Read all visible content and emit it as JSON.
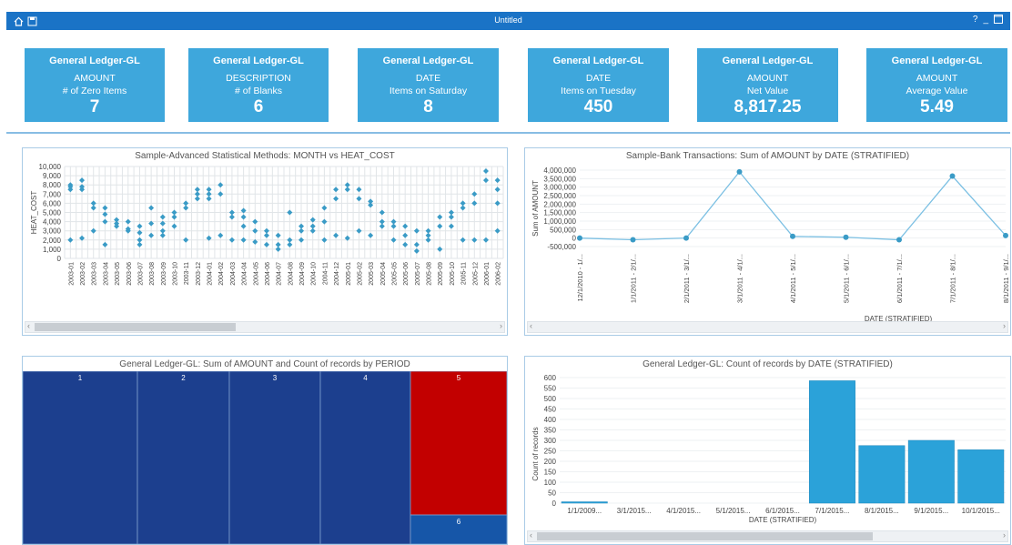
{
  "window": {
    "title": "Untitled",
    "help_label": "?",
    "minimize_label": "_"
  },
  "kpis": [
    {
      "header": "General Ledger-GL",
      "field": "AMOUNT",
      "metric": "# of Zero Items",
      "value": "7"
    },
    {
      "header": "General Ledger-GL",
      "field": "DESCRIPTION",
      "metric": "# of Blanks",
      "value": "6"
    },
    {
      "header": "General Ledger-GL",
      "field": "DATE",
      "metric": "Items on Saturday",
      "value": "8"
    },
    {
      "header": "General Ledger-GL",
      "field": "DATE",
      "metric": "Items on Tuesday",
      "value": "450"
    },
    {
      "header": "General Ledger-GL",
      "field": "AMOUNT",
      "metric": "Net Value",
      "value": "8,817.25"
    },
    {
      "header": "General Ledger-GL",
      "field": "AMOUNT",
      "metric": "Average Value",
      "value": "5.49"
    }
  ],
  "chart_data": [
    {
      "type": "scatter",
      "title": "Sample-Advanced Statistical Methods: MONTH vs HEAT_COST",
      "ylabel": "HEAT_COST",
      "xlabel": "",
      "ylim": [
        0,
        10000
      ],
      "yticks": [
        "10,000",
        "9,000",
        "8,000",
        "7,000",
        "6,000",
        "5,000",
        "4,000",
        "3,000",
        "2,000",
        "1,000",
        "0"
      ],
      "categories": [
        "2003-01",
        "2003-02",
        "2003-03",
        "2003-04",
        "2003-05",
        "2003-06",
        "2003-07",
        "2003-08",
        "2003-09",
        "2003-10",
        "2003-11",
        "2003-12",
        "2004-01",
        "2004-02",
        "2004-03",
        "2004-04",
        "2004-05",
        "2004-06",
        "2004-07",
        "2004-08",
        "2004-09",
        "2004-10",
        "2004-11",
        "2004-12",
        "2005-01",
        "2005-02",
        "2005-03",
        "2005-04",
        "2005-05",
        "2005-06",
        "2005-07",
        "2005-08",
        "2005-09",
        "2005-10",
        "2005-11",
        "2005-12",
        "2006-01",
        "2006-02"
      ],
      "series": [
        {
          "values": [
            [
              2000,
              7500,
              8000,
              7800
            ],
            [
              8500,
              7800,
              7500,
              2200
            ],
            [
              6000,
              5500,
              3000
            ],
            [
              5500,
              4800,
              4000,
              1500
            ],
            [
              4200,
              3500,
              3800
            ],
            [
              4000,
              3200,
              3000
            ],
            [
              3500,
              2800,
              1500,
              2000
            ],
            [
              5500,
              3800,
              2500
            ],
            [
              4500,
              3800,
              3000,
              2500
            ],
            [
              5000,
              4500,
              3500
            ],
            [
              6000,
              5500,
              2000
            ],
            [
              7500,
              6500,
              7000
            ],
            [
              7500,
              6500,
              7000,
              2200
            ],
            [
              8000,
              7000,
              2500
            ],
            [
              5000,
              4500,
              2000
            ],
            [
              5200,
              4500,
              3500,
              2000
            ],
            [
              4000,
              3000,
              1800
            ],
            [
              3000,
              2500,
              1500
            ],
            [
              2500,
              1500,
              1000
            ],
            [
              5000,
              2000,
              1500
            ],
            [
              3500,
              3000,
              2000
            ],
            [
              4200,
              3500,
              3000
            ],
            [
              5500,
              4000,
              2000
            ],
            [
              7500,
              6500,
              2500
            ],
            [
              8000,
              7500,
              2200
            ],
            [
              7500,
              6500,
              3000
            ],
            [
              6200,
              5800,
              2500
            ],
            [
              5000,
              4000,
              3500
            ],
            [
              4000,
              3500,
              2000
            ],
            [
              3500,
              2500,
              1500
            ],
            [
              3000,
              1500,
              800
            ],
            [
              3000,
              2500,
              2000
            ],
            [
              4500,
              3500,
              1000
            ],
            [
              5000,
              4500,
              3500
            ],
            [
              6000,
              5500,
              2000
            ],
            [
              7000,
              6000,
              2000
            ],
            [
              9500,
              8500,
              2000
            ],
            [
              8500,
              7500,
              6000,
              3000
            ]
          ]
        }
      ],
      "scrollbar_position": 0.42
    },
    {
      "type": "line",
      "title": "Sample-Bank Transactions: Sum of AMOUNT by DATE (STRATIFIED)",
      "ylabel": "Sum of AMOUNT",
      "xlabel": "DATE (STRATIFIED)",
      "ylim": [
        -500000,
        4000000
      ],
      "yticks": [
        "4,000,000",
        "3,500,000",
        "3,000,000",
        "2,500,000",
        "2,000,000",
        "1,500,000",
        "1,000,000",
        "500,000",
        "0",
        "-500,000"
      ],
      "categories": [
        "12/1/2010 - 1/...",
        "1/1/2011 - 2/1/...",
        "2/1/2011 - 3/1/...",
        "3/1/2011 - 4/1/...",
        "4/1/2011 - 5/1/...",
        "5/1/2011 - 6/1/...",
        "6/1/2011 - 7/1/...",
        "7/1/2011 - 8/1/...",
        "8/1/2011 - 9/1/..."
      ],
      "series": [
        {
          "values": [
            0,
            -100000,
            0,
            3900000,
            100000,
            50000,
            -100000,
            3650000,
            150000
          ]
        }
      ]
    },
    {
      "type": "treemap",
      "title": "General Ledger-GL: Sum of AMOUNT and Count of records by PERIOD",
      "categories": [
        "1",
        "2",
        "3",
        "4",
        "5",
        "6"
      ],
      "colors": {
        "normal": "#1c3f8e",
        "highlight": "#c20000",
        "alt": "#1656a8"
      }
    },
    {
      "type": "bar",
      "title": "General Ledger-GL: Count of records by DATE (STRATIFIED)",
      "ylabel": "Count of records",
      "xlabel": "DATE (STRATIFIED)",
      "ylim": [
        0,
        600
      ],
      "yticks": [
        "600",
        "550",
        "500",
        "450",
        "400",
        "350",
        "300",
        "250",
        "200",
        "150",
        "100",
        "50",
        "0"
      ],
      "categories": [
        "1/1/2009...",
        "3/1/2015...",
        "4/1/2015...",
        "5/1/2015...",
        "6/1/2015...",
        "7/1/2015...",
        "8/1/2015...",
        "9/1/2015...",
        "10/1/2015..."
      ],
      "values": [
        3,
        0,
        0,
        0,
        0,
        585,
        275,
        300,
        255
      ],
      "scrollbar_position": 0.7
    }
  ]
}
